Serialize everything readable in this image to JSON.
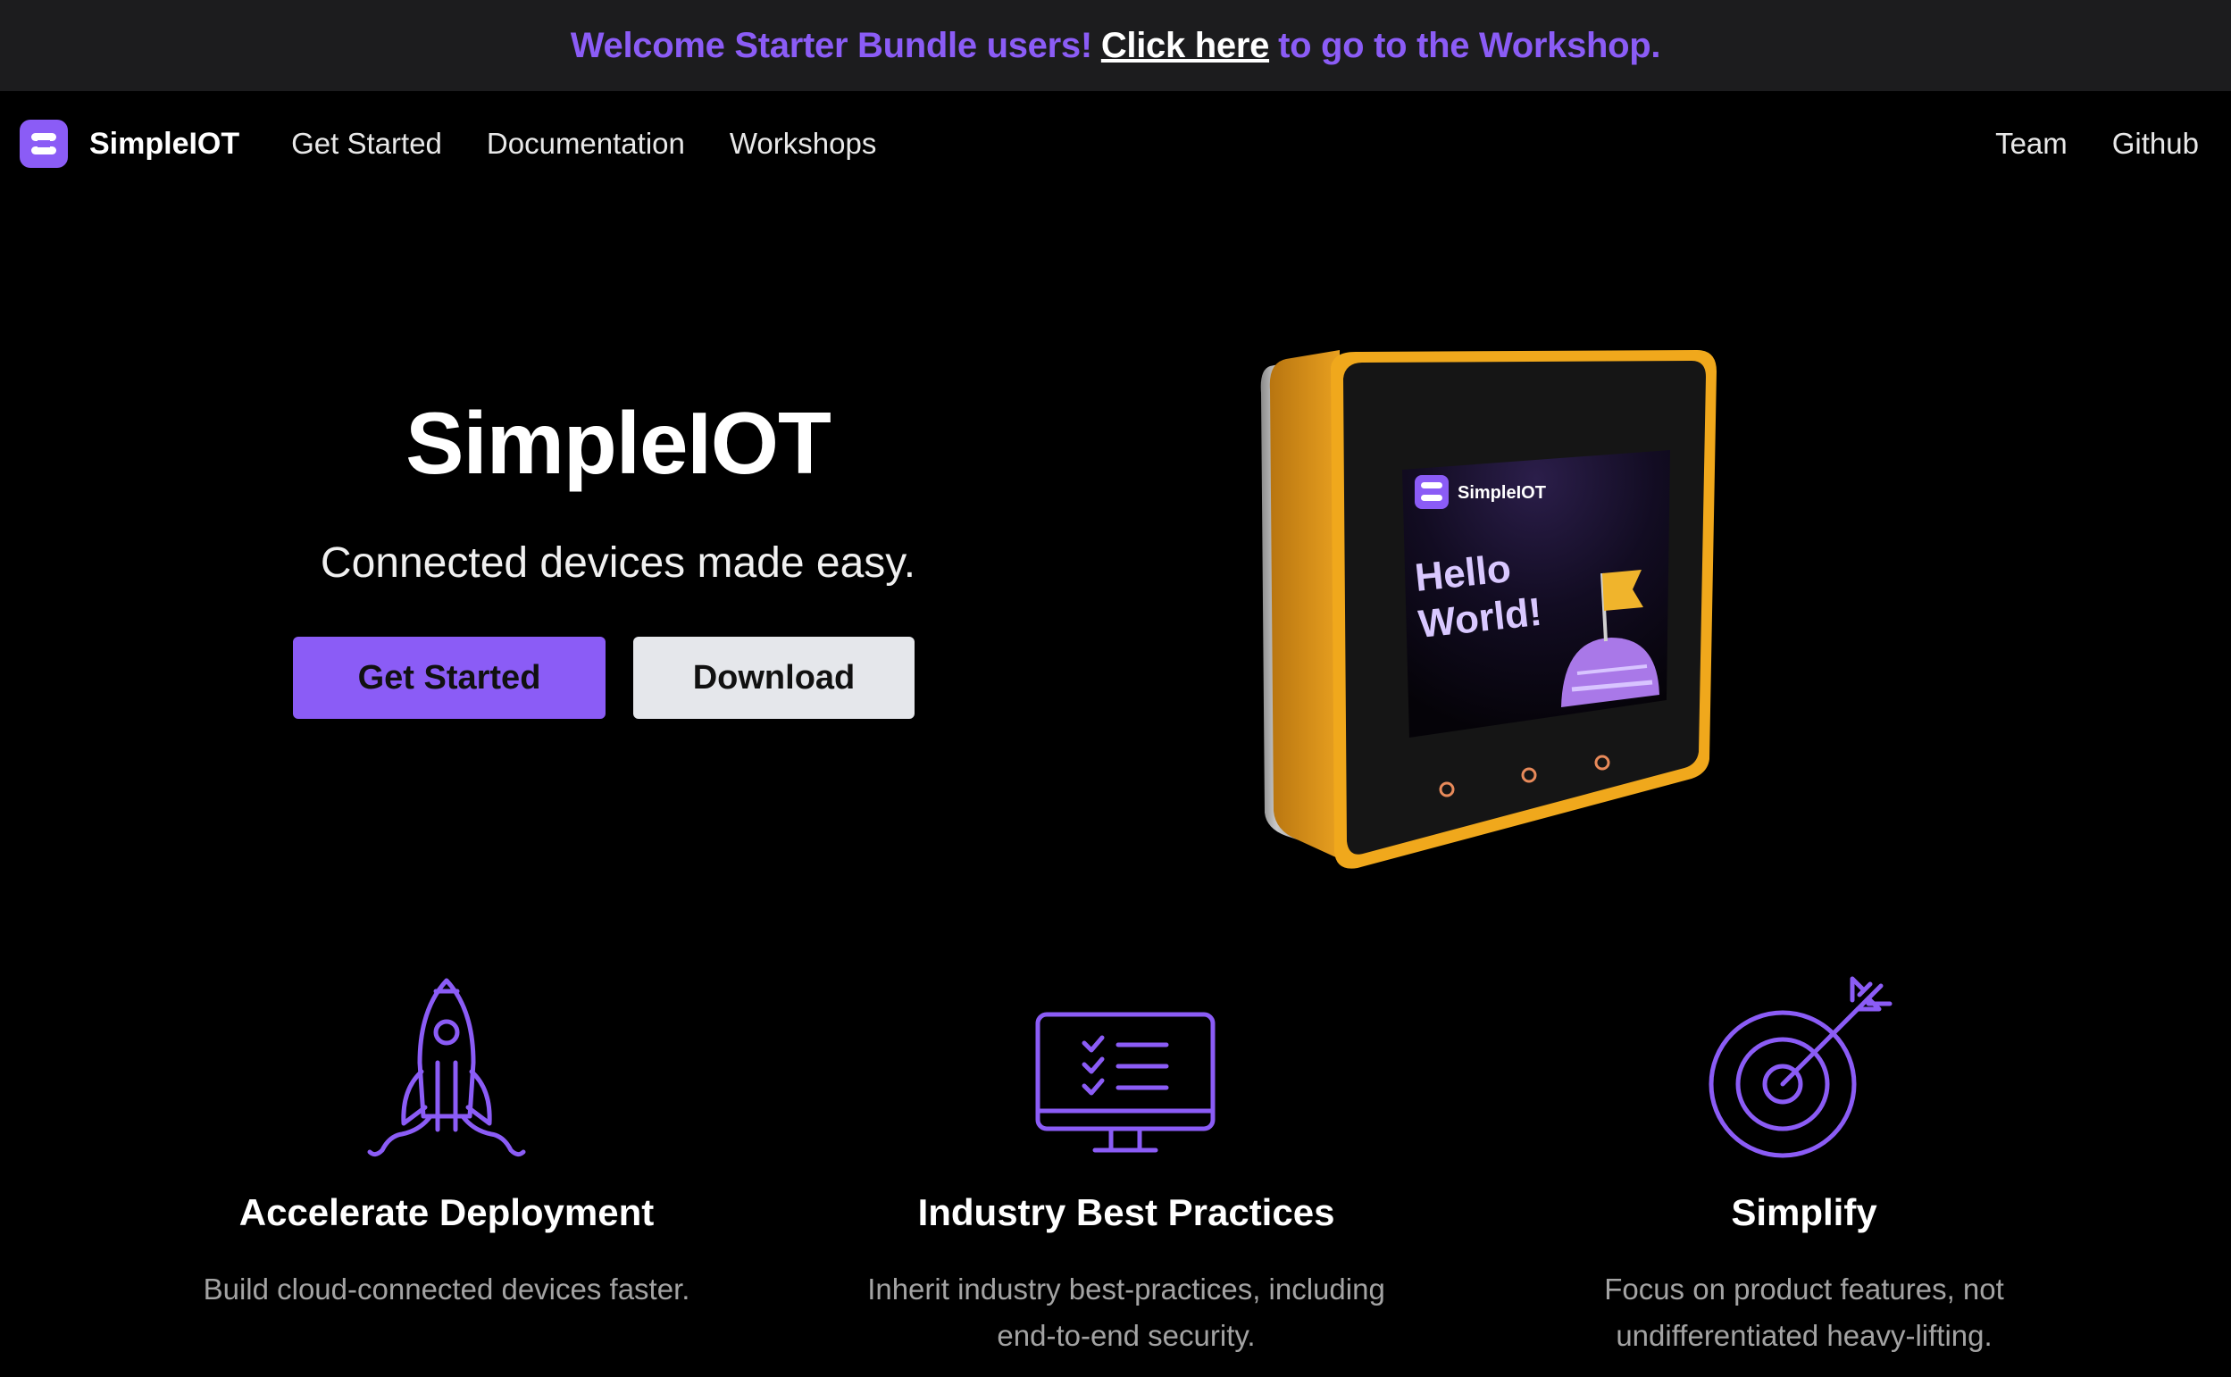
{
  "announcement": {
    "prefix": "Welcome Starter Bundle users!",
    "link": "Click here",
    "suffix": "to go to the Workshop."
  },
  "nav": {
    "brand": "SimpleIOT",
    "links": [
      "Get Started",
      "Documentation",
      "Workshops"
    ],
    "right_links": [
      "Team",
      "Github"
    ]
  },
  "hero": {
    "title": "SimpleIOT",
    "subtitle": "Connected devices made easy.",
    "primary_button": "Get Started",
    "secondary_button": "Download",
    "device_screen": {
      "brand": "SimpleIOT",
      "line1": "Hello",
      "line2": "World!"
    }
  },
  "features": [
    {
      "icon": "rocket-icon",
      "title": "Accelerate Deployment",
      "line1": "Build cloud-connected devices faster.",
      "line2": ""
    },
    {
      "icon": "monitor-checklist-icon",
      "title": "Industry Best Practices",
      "line1": "Inherit industry best-practices, including",
      "line2": "end-to-end security."
    },
    {
      "icon": "target-icon",
      "title": "Simplify",
      "line1": "Focus on product features, not",
      "line2": "undifferentiated heavy-lifting."
    }
  ],
  "colors": {
    "accent": "#8b5cf6",
    "background": "#000000",
    "banner": "#1c1c1e",
    "device_orange": "#e8a020"
  }
}
